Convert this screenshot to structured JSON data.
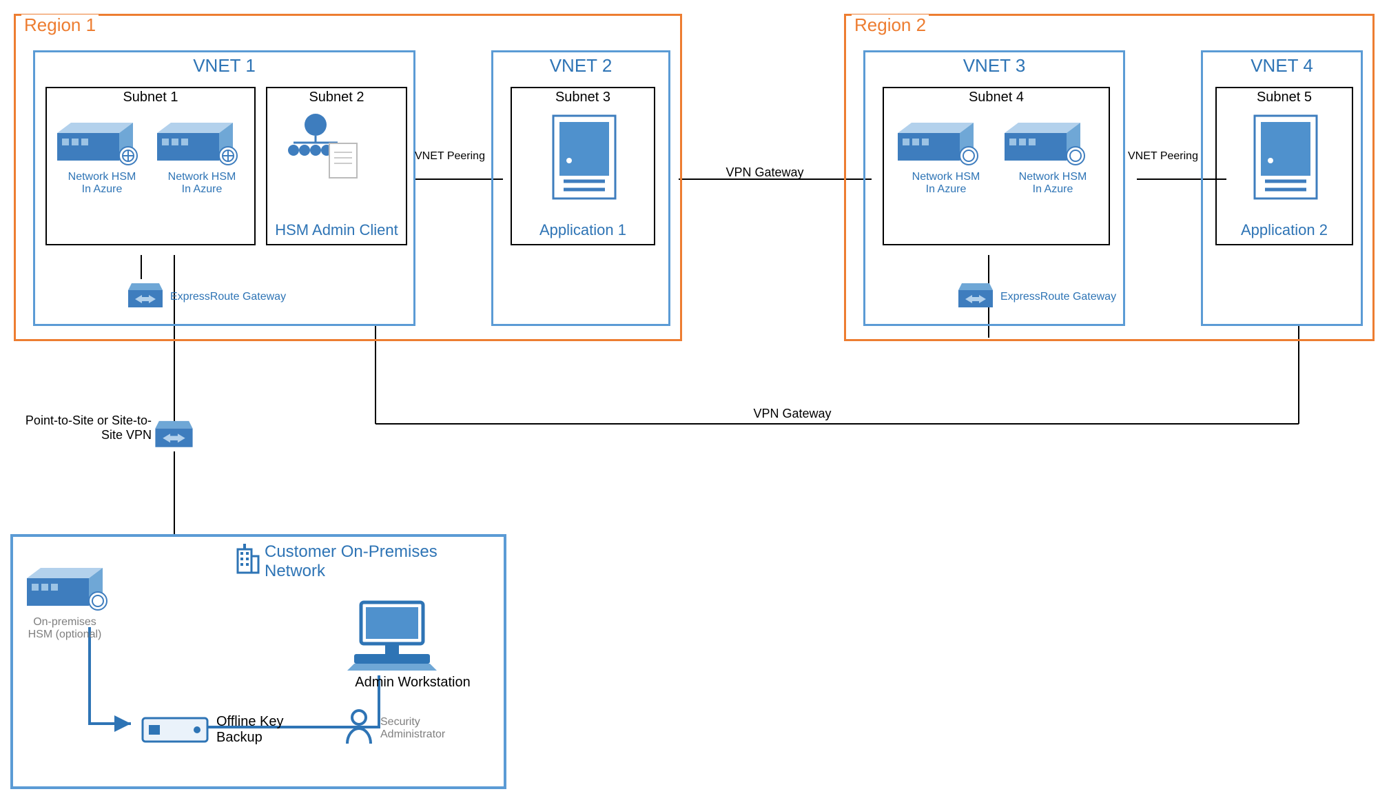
{
  "diagram_type": "Network architecture diagram",
  "regions": {
    "r1": {
      "label": "Region 1"
    },
    "r2": {
      "label": "Region 2"
    }
  },
  "vnets": {
    "v1": {
      "label": "VNET 1"
    },
    "v2": {
      "label": "VNET 2"
    },
    "v3": {
      "label": "VNET 3"
    },
    "v4": {
      "label": "VNET 4"
    }
  },
  "subnets": {
    "s1": {
      "label": "Subnet 1",
      "item1": "Network HSM\nIn Azure",
      "item2": "Network HSM\nIn Azure"
    },
    "s2": {
      "label": "Subnet 2",
      "item": "HSM Admin Client"
    },
    "s3": {
      "label": "Subnet 3",
      "item": "Application 1"
    },
    "s4": {
      "label": "Subnet 4",
      "item1": "Network HSM\nIn Azure",
      "item2": "Network HSM\nIn Azure"
    },
    "s5": {
      "label": "Subnet 5",
      "item": "Application 2"
    }
  },
  "gateways": {
    "er1": "ExpressRoute Gateway",
    "er2": "ExpressRoute Gateway",
    "vpn_label": "Point-to-Site or Site-to-Site VPN"
  },
  "links": {
    "peering1": "VNET Peering",
    "peering2": "VNET Peering",
    "vpn1": "VPN Gateway",
    "vpn2": "VPN Gateway"
  },
  "onprem": {
    "title": "Customer On-Premises Network",
    "hsm": "On-premises HSM (optional)",
    "backup": "Offline Key Backup",
    "workstation": "Admin Workstation",
    "admin": "Security Administrator"
  },
  "colors": {
    "orange": "#ED7D31",
    "blue": "#5B9BD5",
    "blue_dark": "#2E74B5"
  }
}
